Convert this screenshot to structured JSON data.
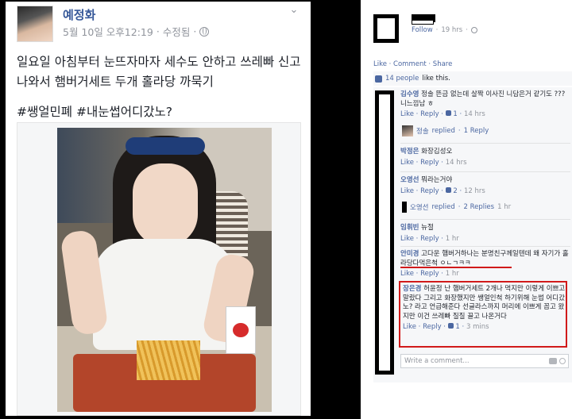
{
  "left_post": {
    "author": "예정화",
    "meta": {
      "timestamp": "5월 10일 오후12:19",
      "separator": "·",
      "edited": "수정됨",
      "separator2": "·"
    },
    "text_line1": "일요일 아침부터 눈뜨자마자 세수도 안하고 쓰레빠 신고",
    "text_line2": "나와서 햄버거세트 두개 홀라당 까묵기",
    "hashtags": "#쌩얼민폐 #내눈썹어디갔노?",
    "icons": [
      "chevron-down-icon",
      "globe-icon"
    ]
  },
  "right_post": {
    "follow": "Follow",
    "dot": "·",
    "time": "19 hrs",
    "actions": "Like · Comment · Share",
    "likes_link": "14 people",
    "likes_suffix": "like this.",
    "comments": [
      {
        "author": "김수영",
        "text": "정솔 뜬금 없는데 살짝 이사진 니담은거 같기도 ??? 니느낌남 ㅎ",
        "like": "Like",
        "reply": "Reply",
        "count": "1",
        "time": "14 hrs"
      },
      {
        "author": "박정은",
        "text": "화장김성오",
        "like": "Like",
        "reply": "Reply",
        "count": "",
        "time": "14 hrs"
      },
      {
        "author": "오영선",
        "text": "뭐라는거야",
        "like": "Like",
        "reply": "Reply",
        "count": "2",
        "time": "12 hrs"
      },
      {
        "author": "임휘빈",
        "text": "뉴절",
        "like": "Like",
        "reply": "Reply",
        "count": "",
        "time": "1 hr"
      },
      {
        "author": "안미경",
        "text": "고다운 햄버거하나는 분명친구께일텐데 왜 자기가 홀라당다먹은척 ㅇㄴㄱㅋㅋ",
        "like": "Like",
        "reply": "Reply",
        "count": "",
        "time": "1 hr"
      },
      {
        "author": "장은경",
        "text": "허윤정 난 햄버거세트 2개나 먹지만 이렇게 이쁘고 말랐다 그리고 화장했지만 쌩얼인척 하기위해 눈썹 어디갔노? 라고 언급해준다 선글라스까지 머리에 이쁘게 꼽고 왔지만 이건 쓰레빠 질질 끌고 나온거다",
        "like": "Like",
        "reply": "Reply",
        "count": "1",
        "time": "3 mins"
      }
    ],
    "replies": [
      {
        "name": "정솔",
        "verb": "replied",
        "dot": "·",
        "count": "1 Reply"
      },
      {
        "name": "오영선",
        "verb": "replied",
        "dot": "·",
        "count": "2 Replies",
        "time": "1 hr"
      }
    ],
    "write_placeholder": "Write a comment...",
    "icons": [
      "camera-icon",
      "sticker-icon",
      "thumb-icon",
      "globe-icon"
    ],
    "accent": "#4b67a1",
    "highlight_color": "#d11a1a"
  }
}
